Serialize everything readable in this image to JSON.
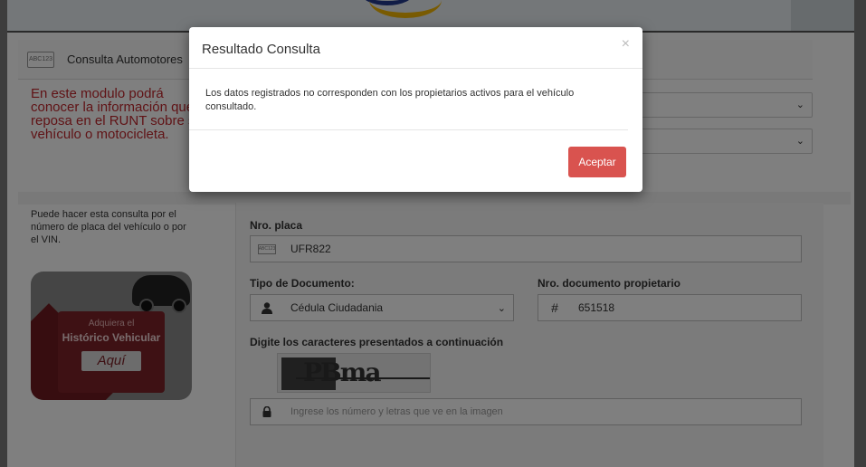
{
  "header": {
    "module_title": "Consulta Automotores",
    "plate_badge": "ABC123"
  },
  "intro_text": "En este modulo podrá conocer la información que reposa en el RUNT sobre su vehículo o motocicleta.",
  "help_text": "Puede hacer esta consulta por el número de placa del vehículo o por el VIN.",
  "promo": {
    "line1": "Adquiera el",
    "line2": "Histórico Vehicular",
    "button": "Aquí"
  },
  "form": {
    "plate_label": "Nro. placa",
    "plate_badge": "ABC123",
    "plate_value": "UFR822",
    "doc_type_label": "Tipo de Documento:",
    "doc_type_value": "Cédula Ciudadania",
    "doc_number_label": "Nro. documento propietario",
    "doc_number_value": "651518",
    "captcha_label": "Digite los caracteres presentados a continuación",
    "captcha_placeholder": "Ingrese los número y letras que ve en la imagen"
  },
  "modal": {
    "title": "Resultado Consulta",
    "close": "×",
    "message": "Los datos registrados no corresponden con los propietarios activos para el vehículo consultado.",
    "accept_label": "Aceptar"
  },
  "colors": {
    "accent_red": "#d9534f",
    "intro_red": "#c0272d"
  }
}
